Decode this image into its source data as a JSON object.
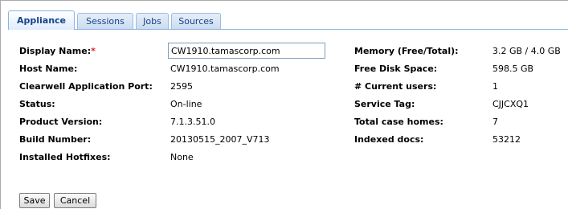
{
  "tabs": [
    {
      "label": "Appliance",
      "active": true
    },
    {
      "label": "Sessions",
      "active": false
    },
    {
      "label": "Jobs",
      "active": false
    },
    {
      "label": "Sources",
      "active": false
    }
  ],
  "left": {
    "display_name_label": "Display Name:",
    "required_marker": "*",
    "display_name_value": "CW1910.tamascorp.com",
    "host_name_label": "Host Name:",
    "host_name_value": "CW1910.tamascorp.com",
    "port_label": "Clearwell Application Port:",
    "port_value": "2595",
    "status_label": "Status:",
    "status_value": "On-line",
    "product_version_label": "Product Version:",
    "product_version_value": "7.1.3.51.0",
    "build_number_label": "Build Number:",
    "build_number_value": "20130515_2007_V713",
    "hotfixes_label": "Installed Hotfixes:",
    "hotfixes_value": "None"
  },
  "right": {
    "memory_label": "Memory (Free/Total):",
    "memory_value": "3.2 GB / 4.0 GB",
    "disk_label": "Free Disk Space:",
    "disk_value": "598.5 GB",
    "users_label": "# Current users:",
    "users_value": "1",
    "service_tag_label": "Service Tag:",
    "service_tag_value": "CJJCXQ1",
    "case_homes_label": "Total case homes:",
    "case_homes_value": "7",
    "indexed_docs_label": "Indexed docs:",
    "indexed_docs_value": "53212"
  },
  "buttons": {
    "save": "Save",
    "cancel": "Cancel"
  },
  "colors": {
    "tab_text": "#15428b",
    "tab_border": "#8db2e3",
    "required": "#e0231b"
  }
}
